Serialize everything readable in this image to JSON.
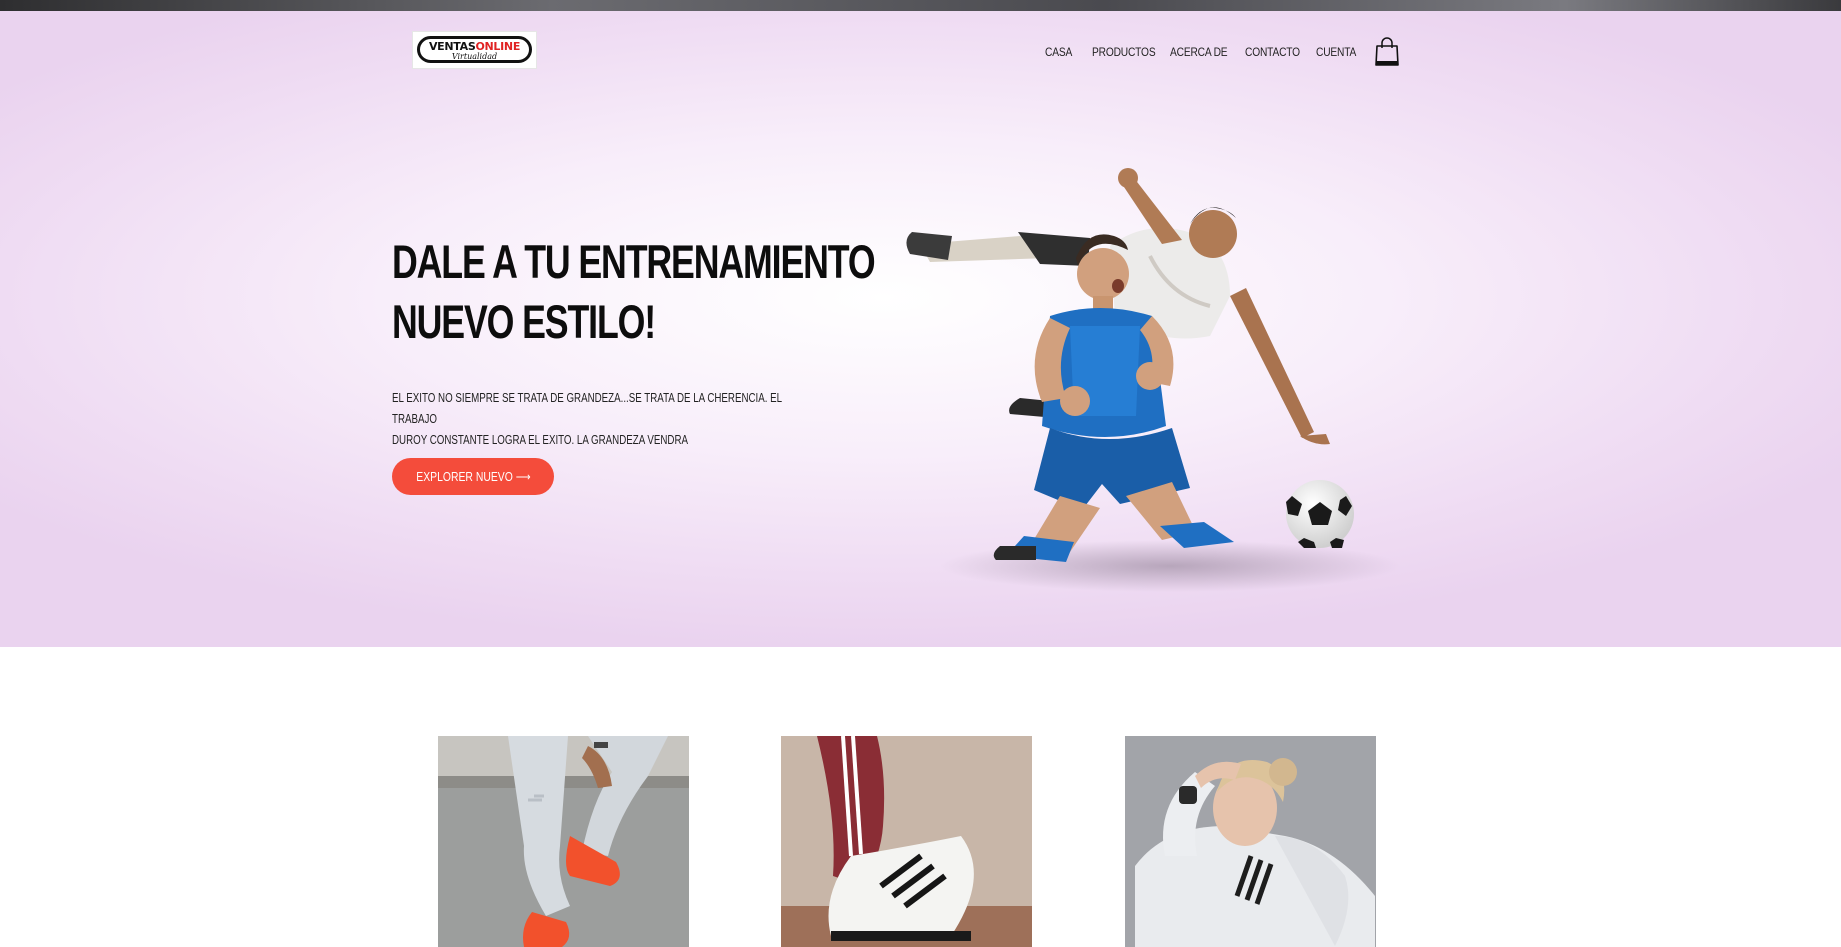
{
  "header": {
    "logo": {
      "main": "VENTAS",
      "accent": "ONLINE",
      "sub": "Virtualidad"
    },
    "nav": [
      {
        "label": "CASA"
      },
      {
        "label": "PRODUCTOS"
      },
      {
        "label": "ACERCA DE"
      },
      {
        "label": "CONTACTO"
      },
      {
        "label": "CUENTA"
      }
    ],
    "cart_icon": "shopping-bag-icon"
  },
  "hero": {
    "title_line1": "DALE A TU ENTRENAMIENTO",
    "title_line2": "NUEVO ESTILO!",
    "description_line1": "EL EXITO NO SIEMPRE SE TRATA DE GRANDEZA...SE TRATA DE LA CHERENCIA. EL TRABAJO",
    "description_line2": "DUROY CONSTANTE LOGRA EL EXITO. LA GRANDEZA VENDRA",
    "button_label": "EXPLORER NUEVO ⟶",
    "image": "soccer-players-image"
  },
  "products": [
    {
      "image": "orange-sneakers-image"
    },
    {
      "image": "striped-pants-sneaker-image"
    },
    {
      "image": "woman-white-hoodie-image"
    }
  ],
  "colors": {
    "accent": "#f44c3b",
    "hero_bg": "#efdcf3",
    "text": "#0d0d0d"
  }
}
